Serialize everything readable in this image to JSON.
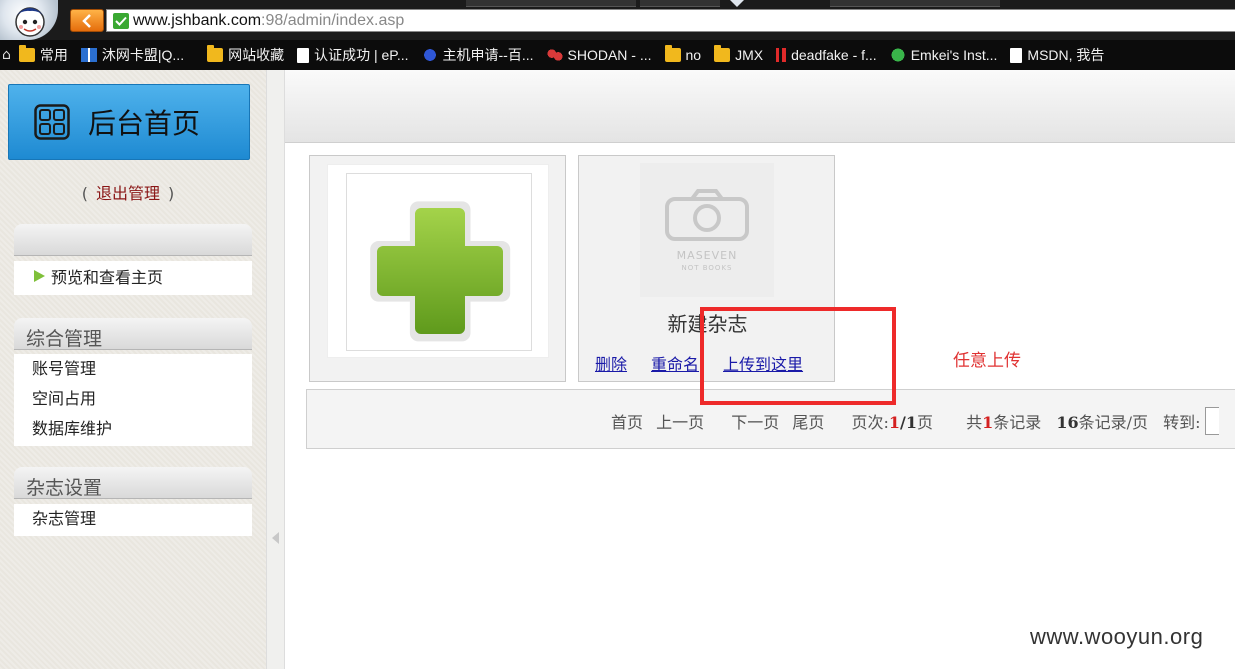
{
  "browser": {
    "url_host": "www.jshbank.com",
    "url_rest": ":98/admin/index.asp",
    "bookmarks": [
      {
        "label": "常用",
        "icon": "folder-icon"
      },
      {
        "label": "沐网卡盟|Q...",
        "icon": "site-icon"
      },
      {
        "label": "网站收藏",
        "icon": "folder-icon"
      },
      {
        "label": "认证成功 | eP...",
        "icon": "page-icon"
      },
      {
        "label": "主机申请--百...",
        "icon": "baidu-paw-icon"
      },
      {
        "label": "SHODAN - ...",
        "icon": "shodan-icon"
      },
      {
        "label": "no",
        "icon": "folder-icon"
      },
      {
        "label": "JMX",
        "icon": "folder-icon"
      },
      {
        "label": "deadfake - f...",
        "icon": "bars-icon"
      },
      {
        "label": "Emkei's Inst...",
        "icon": "emkei-icon"
      },
      {
        "label": "MSDN, 我告",
        "icon": "page-icon"
      }
    ]
  },
  "sidebar": {
    "home_label": "后台首页",
    "logout_open": "(",
    "logout_label": "退出管理",
    "logout_close": ")",
    "sections": [
      {
        "title": "",
        "items": [
          "预览和查看主页"
        ]
      },
      {
        "title": "综合管理",
        "items": [
          "账号管理",
          "空间占用",
          "数据库维护"
        ]
      },
      {
        "title": "杂志设置",
        "items": [
          "杂志管理"
        ]
      }
    ]
  },
  "magazine": {
    "cover_line1": "MASEVEN",
    "cover_line2": "NOT BOOKS",
    "title": "新建杂志",
    "links": [
      "删除",
      "重命名",
      "上传到这里"
    ]
  },
  "pager": {
    "first": "首页",
    "prev": "上一页",
    "next": "下一页",
    "last": "尾页",
    "page_prefix": "页次:",
    "page_current": "1",
    "page_total": "/1",
    "page_suffix": "页",
    "total_prefix": "共",
    "total_count": "1",
    "total_suffix": "条记录",
    "per_page": "16",
    "per_page_suffix": "条记录/页",
    "jump_label": "转到:"
  },
  "annotation": {
    "text": "任意上传",
    "color": "#ee2a2a"
  },
  "watermark": "www.wooyun.org",
  "colors": {
    "home_button": "#2e9ade",
    "plus_green": "#7fba2e",
    "link_blue": "#1a1aa8"
  }
}
